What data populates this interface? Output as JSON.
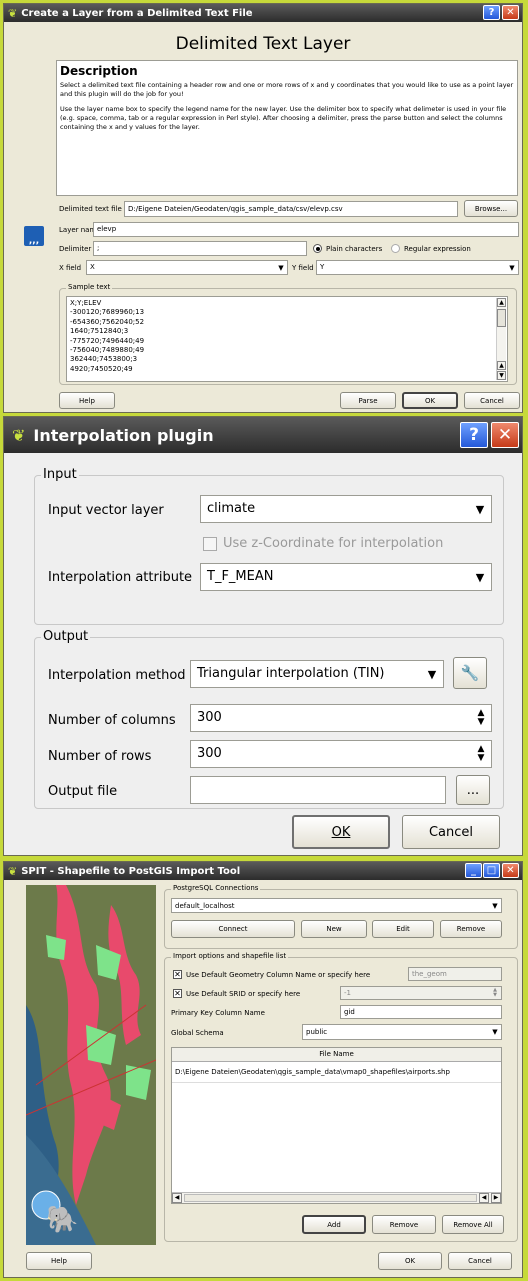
{
  "w1": {
    "title": "Create a Layer from a Delimited Text File",
    "heading": "Delimited Text Layer",
    "desc_title": "Description",
    "desc_p1": "Select a delimited text file containing a header row and one or more rows of x and y coordinates that you would like to use as a point layer and this plugin will do the job for you!",
    "desc_p2": "Use the layer name box to specify the legend name for the new layer. Use the delimiter box to specify what delimeter is used in your file (e.g. space, comma, tab or a regular expression in Perl style). After choosing a delimiter, press the parse button and select the columns containing the x and y values for the layer.",
    "file_label": "Delimited text file",
    "file_value": "D:/Eigene Dateien/Geodaten/qgis_sample_data/csv/elevp.csv",
    "browse": "Browse...",
    "layer_label": "Layer name",
    "layer_value": "elevp",
    "delim_label": "Delimiter",
    "delim_value": ";",
    "plain": "Plain characters",
    "regex": "Regular expression",
    "xfield_label": "X field",
    "xfield_value": "X",
    "yfield_label": "Y field",
    "yfield_value": "Y",
    "sample_label": "Sample text",
    "sample": [
      "X;Y;ELEV",
      "-300120;7689960;13",
      "-654360;7562040;52",
      "1640;7512840;3",
      "-775720;7496440;49",
      "-756040;7489880;49",
      "362440;7453800;3",
      "4920;7450520;49"
    ],
    "help": "Help",
    "parse": "Parse",
    "ok": "OK",
    "cancel": "Cancel"
  },
  "w2": {
    "title": "Interpolation plugin",
    "input_group": "Input",
    "input_layer_label": "Input vector layer",
    "input_layer_value": "climate",
    "zcoord": "Use z-Coordinate for interpolation",
    "attr_label": "Interpolation attribute",
    "attr_value": "T_F_MEAN",
    "output_group": "Output",
    "method_label": "Interpolation method",
    "method_value": "Triangular interpolation (TIN)",
    "cols_label": "Number of columns",
    "cols_value": "300",
    "rows_label": "Number of rows",
    "rows_value": "300",
    "outfile_label": "Output file",
    "outfile_value": "",
    "browse": "...",
    "ok": "OK",
    "cancel": "Cancel"
  },
  "w3": {
    "title": "SPIT - Shapefile to PostGIS Import Tool",
    "conn_group": "PostgreSQL Connections",
    "conn_value": "default_localhost",
    "connect": "Connect",
    "new": "New",
    "edit": "Edit",
    "remove": "Remove",
    "import_group": "Import options and shapefile list",
    "geom_label": "Use Default Geometry Column Name or specify here",
    "geom_value": "the_geom",
    "srid_label": "Use Default SRID or specify here",
    "srid_value": "-1",
    "pk_label": "Primary Key Column Name",
    "pk_value": "gid",
    "schema_label": "Global Schema",
    "schema_value": "public",
    "col_header": "File Name",
    "files": [
      "D:\\Eigene Dateien\\Geodaten\\qgis_sample_data\\vmap0_shapefiles\\airports.shp"
    ],
    "add": "Add",
    "remove_file": "Remove",
    "remove_all": "Remove All",
    "help": "Help",
    "ok": "OK",
    "cancel": "Cancel"
  },
  "colors": {
    "background": "#c6d93a",
    "titlebar": "#2c2c2c",
    "close": "#c53a18"
  }
}
